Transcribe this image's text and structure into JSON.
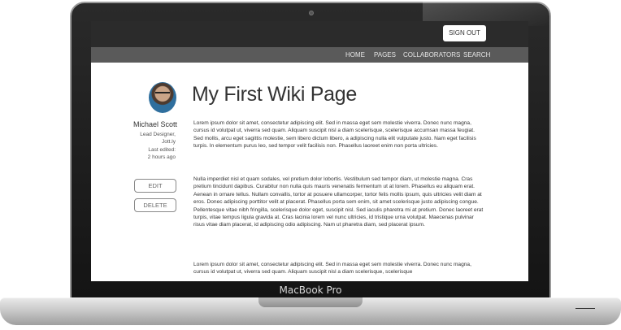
{
  "device": {
    "brand": "MacBook Pro"
  },
  "header": {
    "signout_label": "SIGN OUT"
  },
  "nav": {
    "items": [
      {
        "label": "HOME"
      },
      {
        "label": "PAGES"
      },
      {
        "label": "COLLABORATORS"
      },
      {
        "label": "SEARCH"
      }
    ]
  },
  "profile": {
    "name": "Michael Scott",
    "role_line1": "Lead Designer,",
    "role_line2": "Jott.ly",
    "edited_line1": "Last edited:",
    "edited_line2": "2 hours ago",
    "edit_label": "EDIT",
    "delete_label": "DELETE"
  },
  "page": {
    "title": "My First Wiki Page",
    "paragraphs": [
      "Lorem ipsum dolor sit amet, consectetur adipiscing elit. Sed in massa eget sem molestie viverra. Donec nunc magna, cursus id volutpat ut, viverra sed quam. Aliquam suscipit nisl a diam scelerisque, scelerisque accumsan massa feugiat. Sed mollis, arcu eget sagittis molestie, sem libero dictum libero, a adipiscing nulla elit vulputate justo. Nam eget facilisis turpis. In elementum purus leo, sed tempor velit facilisis non. Phasellus laoreet enim non porta ultricies.",
      "Nulla imperdiet nisl et quam sodales, vel pretium dolor lobortis. Vestibulum sed tempor diam, ut molestie magna. Cras pretium tincidunt dapibus. Curabitur non nulla quis mauris venenatis fermentum ut at lorem. Phasellus eu aliquam erat. Aenean in ornare tellus. Nullam convallis, tortor at posuere ullamcorper, tortor felis mollis ipsum, quis ultricies velit diam at eros. Donec adipiscing porttitor velit at placerat. Phasellus porta sem enim, sit amet scelerisque justo adipiscing congue. Pellentesque vitae nibh fringilla, scelerisque dolor eget, suscipit nisl. Sed iaculis pharetra mi at pretium. Donec laoreet erat turpis, vitae tempus ligula gravida at. Cras lacinia lorem vel nunc ultricies, id tristique urna volutpat. Maecenas pulvinar risus vitae diam placerat, id adipiscing odio adipiscing. Nam ut pharetra diam, sed placerat ipsum.",
      "Lorem ipsum dolor sit amet, consectetur adipiscing elit. Sed in massa eget sem molestie viverra. Donec nunc magna, cursus id volutpat ut, viverra sed quam. Aliquam suscipit nisl a diam scelerisque, scelerisque"
    ]
  }
}
